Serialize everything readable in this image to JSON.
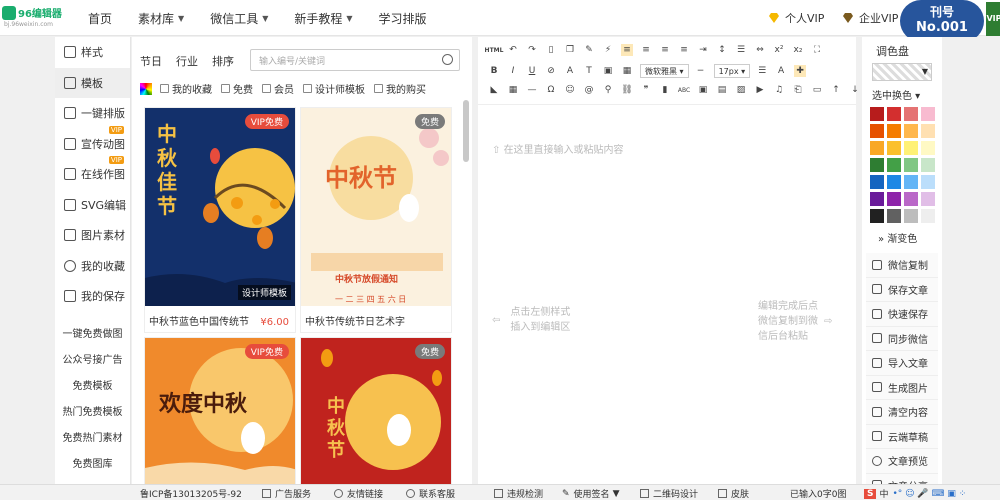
{
  "brand": {
    "name": "96编辑器",
    "domain": "bj.96weixin.com"
  },
  "nav": [
    {
      "label": "首页",
      "caret": false
    },
    {
      "label": "素材库",
      "caret": true
    },
    {
      "label": "微信工具",
      "caret": true
    },
    {
      "label": "新手教程",
      "caret": true
    },
    {
      "label": "学习排版",
      "caret": false
    }
  ],
  "vip": {
    "personal": "个人VIP",
    "enterprise": "企业VIP"
  },
  "issue": {
    "line1": "刊号",
    "line2": "No.001",
    "badge": "VIP"
  },
  "leftnav": {
    "items": [
      {
        "label": "样式",
        "tag": ""
      },
      {
        "label": "模板",
        "tag": "",
        "active": true
      },
      {
        "label": "一键排版",
        "tag": ""
      },
      {
        "label": "宣传动图",
        "tag": "VIP"
      },
      {
        "label": "在线作图",
        "tag": "VIP"
      },
      {
        "label": "SVG编辑",
        "tag": ""
      },
      {
        "label": "图片素材",
        "tag": ""
      },
      {
        "label": "我的收藏",
        "tag": ""
      },
      {
        "label": "我的保存",
        "tag": ""
      }
    ],
    "links": [
      "一键免费做图",
      "公众号接广告",
      "免费模板",
      "热门免费模板",
      "免费热门素材",
      "免费图库"
    ]
  },
  "panel": {
    "filters": [
      "节日",
      "行业",
      "排序"
    ],
    "search_placeholder": "输入编号/关键词",
    "checks": [
      "我的收藏",
      "免费",
      "会员",
      "设计师模板",
      "我的购买"
    ],
    "cards": [
      {
        "title": "中秋节蓝色中国传统节",
        "price": "¥6.00",
        "badge": "VIP免费",
        "designer_tag": "设计师模板",
        "art_text": "中秋佳节",
        "theme": "blue"
      },
      {
        "title": "中秋节传统节日艺术字",
        "price": "",
        "badge": "免费",
        "designer_tag": "",
        "art_text": "中秋节",
        "banner": "中秋节放假通知",
        "days": "一 二 三 四 五 六 日",
        "theme": "cream"
      },
      {
        "title": "",
        "price": "",
        "badge": "VIP免费",
        "designer_tag": "",
        "art_text": "欢度中秋",
        "theme": "orange"
      },
      {
        "title": "",
        "price": "",
        "badge": "免费",
        "designer_tag": "",
        "art_text": "中秋节",
        "theme": "red"
      }
    ]
  },
  "editor": {
    "hint_top": "在这里直接输入或粘贴内容",
    "hint_left": "点击左侧样式\n插入到编辑区",
    "hint_right": "编辑完成后点\n微信复制到微\n信后台粘贴",
    "font_name": "微软雅黑",
    "font_size": "17px"
  },
  "palette": {
    "title": "调色盘",
    "pick_label": "选中换色",
    "gradient_label": "渐变色",
    "colors": [
      "#b71c1c",
      "#d32f2f",
      "#e57373",
      "#f8bbd0",
      "#e65100",
      "#f57c00",
      "#ffb74d",
      "#ffe0b2",
      "#f9a825",
      "#fbc02d",
      "#fff176",
      "#fff9c4",
      "#2e7d32",
      "#43a047",
      "#81c784",
      "#c8e6c9",
      "#1565c0",
      "#1e88e5",
      "#64b5f6",
      "#bbdefb",
      "#6a1b9a",
      "#8e24aa",
      "#ba68c8",
      "#e1bee7",
      "#212121",
      "#616161",
      "#bdbdbd",
      "#eeeeee"
    ]
  },
  "actions": [
    "微信复制",
    "保存文章",
    "快速保存",
    "同步微信",
    "导入文章",
    "生成图片",
    "清空内容",
    "云端草稿",
    "文章预览",
    "文章分享"
  ],
  "footer": {
    "icp": "鲁ICP备13013205号-92",
    "ad": "广告服务",
    "links": "友情链接",
    "service": "联系客服",
    "check": "违规检测",
    "signature": "使用签名",
    "qrcode": "二维码设计",
    "skin": "皮肤",
    "count": "已输入0字0图",
    "ime": "中"
  }
}
